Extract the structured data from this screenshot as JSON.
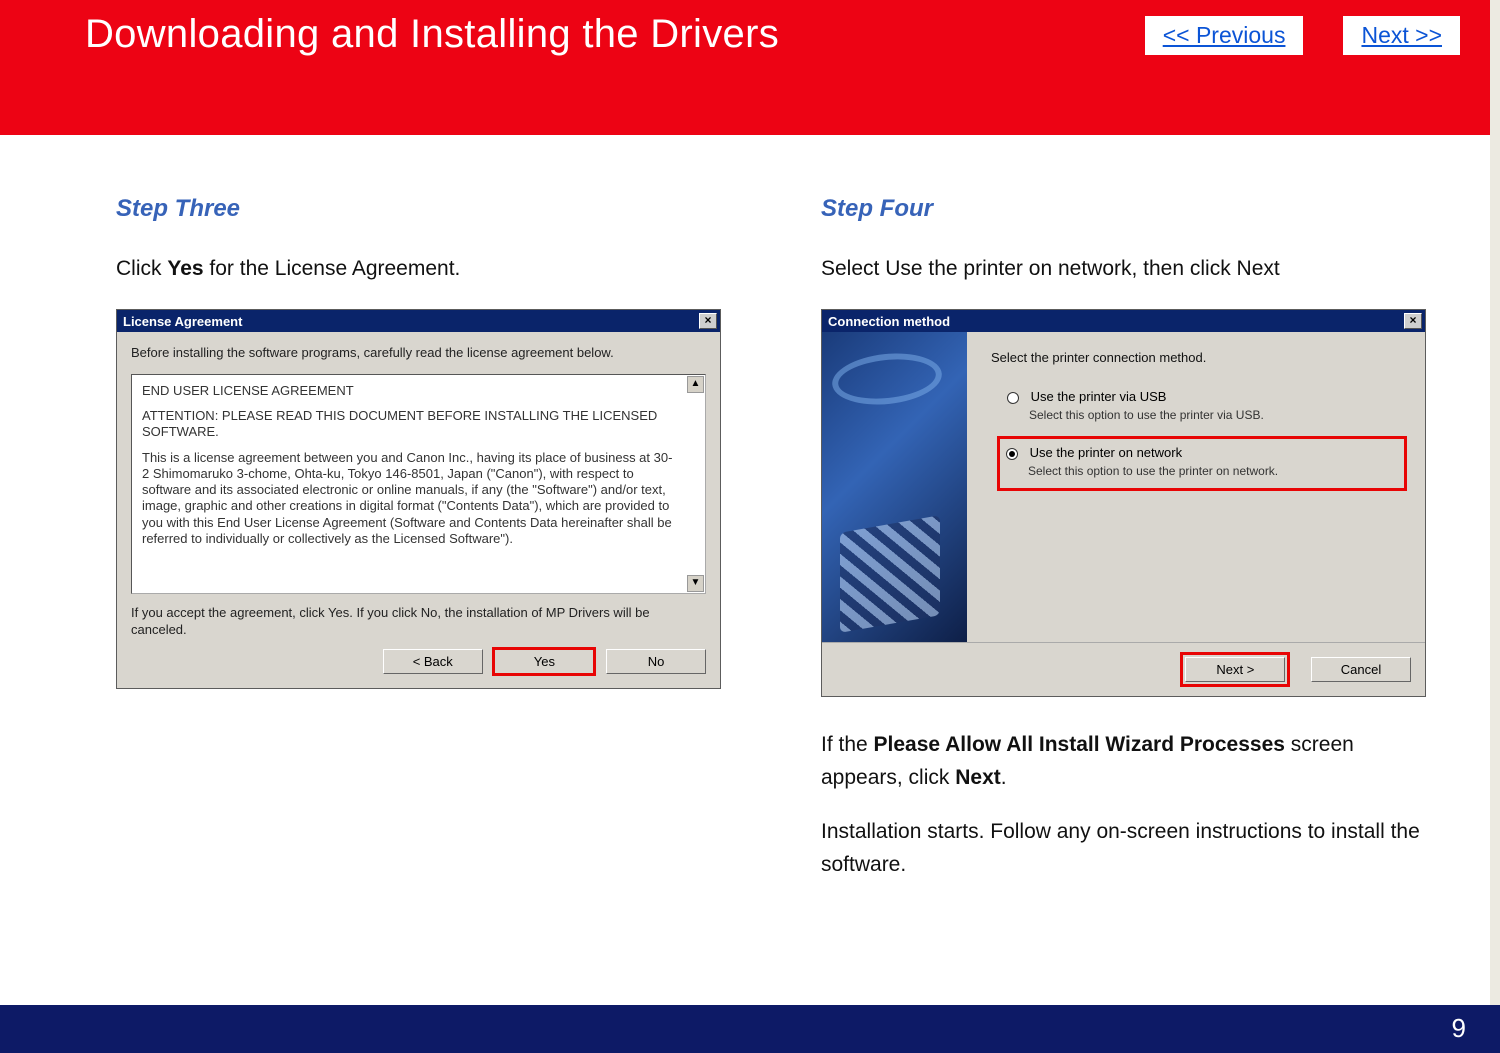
{
  "header": {
    "title": "Downloading and Installing  the Drivers",
    "prev": " << Previous",
    "next": "Next >>"
  },
  "left": {
    "step": "Step Three",
    "instruction_prefix": "Click ",
    "instruction_bold": "Yes",
    "instruction_suffix": " for the License Agreement.",
    "dialog": {
      "title": "License Agreement",
      "intro": "Before installing the software programs, carefully read the license agreement below.",
      "eula_heading": "END USER LICENSE AGREEMENT",
      "eula_attention": "ATTENTION: PLEASE READ THIS DOCUMENT BEFORE INSTALLING THE LICENSED SOFTWARE.",
      "eula_body": "This is a license agreement between you and Canon Inc., having its place of business at 30-2 Shimomaruko 3-chome, Ohta-ku, Tokyo 146-8501, Japan (\"Canon\"), with respect to software and its associated electronic or online manuals, if any (the \"Software\") and/or text, image, graphic and other creations in digital format (\"Contents Data\"), which are provided to you with this End User License Agreement (Software and Contents Data hereinafter shall be referred to individually or collectively as the Licensed Software\").",
      "accept_text": "If you accept the agreement, click Yes. If you click No, the installation of MP Drivers will be canceled.",
      "btn_back": "< Back",
      "btn_yes": "Yes",
      "btn_no": "No",
      "close": "×",
      "scroll_up": "▲",
      "scroll_down": "▼"
    }
  },
  "right": {
    "step": "Step Four",
    "instruction": "Select  Use the printer on network, then click Next",
    "dialog": {
      "title": "Connection method",
      "prompt": "Select the printer connection method.",
      "opt1_label": "Use the printer via USB",
      "opt1_desc": "Select this option to use the printer via USB.",
      "opt2_label": "Use the printer on network",
      "opt2_desc": "Select this option to use the printer on network.",
      "btn_next": "Next >",
      "btn_cancel": "Cancel",
      "close": "×"
    },
    "extra1_pre": " If the ",
    "extra1_b1": "Please Allow All Install Wizard Processes",
    "extra1_mid": " screen appears, click ",
    "extra1_b2": "Next",
    "extra1_post": ".",
    "extra2": "Installation starts. Follow any on-screen instructions to install the software."
  },
  "page_number": "9"
}
